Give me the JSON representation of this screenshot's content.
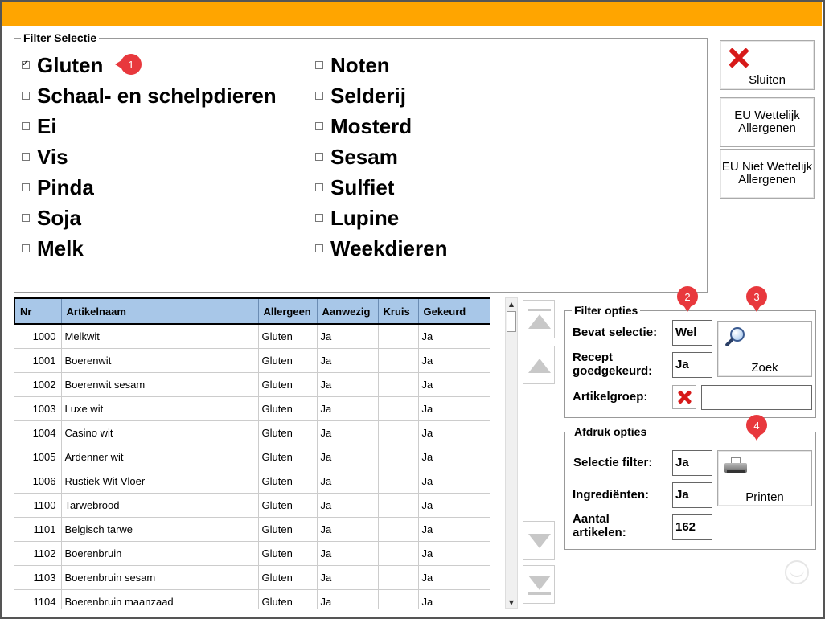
{
  "filter_selectie": {
    "title": "Filter Selectie",
    "left_column": [
      {
        "label": "Gluten",
        "checked": true
      },
      {
        "label": "Schaal- en schelpdieren",
        "checked": false
      },
      {
        "label": "Ei",
        "checked": false
      },
      {
        "label": "Vis",
        "checked": false
      },
      {
        "label": "Pinda",
        "checked": false
      },
      {
        "label": "Soja",
        "checked": false
      },
      {
        "label": "Melk",
        "checked": false
      }
    ],
    "right_column": [
      {
        "label": "Noten",
        "checked": false
      },
      {
        "label": "Selderij",
        "checked": false
      },
      {
        "label": "Mosterd",
        "checked": false
      },
      {
        "label": "Sesam",
        "checked": false
      },
      {
        "label": "Sulfiet",
        "checked": false
      },
      {
        "label": "Lupine",
        "checked": false
      },
      {
        "label": "Weekdieren",
        "checked": false
      }
    ]
  },
  "badges": [
    "1",
    "2",
    "3",
    "4"
  ],
  "buttons": {
    "sluiten": "Sluiten",
    "eu_wettelijk_line1": "EU Wettelijk",
    "eu_wettelijk_line2": "Allergenen",
    "eu_niet_line1": "EU Niet Wettelijk",
    "eu_niet_line2": "Allergenen"
  },
  "table": {
    "columns": [
      "Nr",
      "Artikelnaam",
      "Allergeen",
      "Aanwezig",
      "Kruis",
      "Gekeurd"
    ],
    "rows": [
      [
        "1000",
        "Melkwit",
        "Gluten",
        "Ja",
        "",
        "Ja"
      ],
      [
        "1001",
        "Boerenwit",
        "Gluten",
        "Ja",
        "",
        "Ja"
      ],
      [
        "1002",
        "Boerenwit sesam",
        "Gluten",
        "Ja",
        "",
        "Ja"
      ],
      [
        "1003",
        "Luxe wit",
        "Gluten",
        "Ja",
        "",
        "Ja"
      ],
      [
        "1004",
        "Casino wit",
        "Gluten",
        "Ja",
        "",
        "Ja"
      ],
      [
        "1005",
        "Ardenner wit",
        "Gluten",
        "Ja",
        "",
        "Ja"
      ],
      [
        "1006",
        "Rustiek Wit Vloer",
        "Gluten",
        "Ja",
        "",
        "Ja"
      ],
      [
        "1100",
        "Tarwebrood",
        "Gluten",
        "Ja",
        "",
        "Ja"
      ],
      [
        "1101",
        "Belgisch tarwe",
        "Gluten",
        "Ja",
        "",
        "Ja"
      ],
      [
        "1102",
        "Boerenbruin",
        "Gluten",
        "Ja",
        "",
        "Ja"
      ],
      [
        "1103",
        "Boerenbruin sesam",
        "Gluten",
        "Ja",
        "",
        "Ja"
      ],
      [
        "1104",
        "Boerenbruin maanzaad",
        "Gluten",
        "Ja",
        "",
        "Ja"
      ]
    ]
  },
  "filter_opties": {
    "title": "Filter opties",
    "bevat_selectie_label": "Bevat selectie:",
    "bevat_selectie_value": "Wel",
    "recept_label_line1": "Recept",
    "recept_label_line2": "goedgekeurd:",
    "recept_value": "Ja",
    "artikelgroep_label": "Artikelgroep:",
    "artikelgroep_value": "",
    "zoek_label": "Zoek"
  },
  "afdruk_opties": {
    "title": "Afdruk opties",
    "selectie_filter_label": "Selectie filter:",
    "selectie_filter_value": "Ja",
    "ingredienten_label": "Ingrediënten:",
    "ingredienten_value": "Ja",
    "aantal_label_line1": "Aantal",
    "aantal_label_line2": "artikelen:",
    "aantal_value": "162",
    "printen_label": "Printen"
  },
  "colors": {
    "topbar": "#FFA500",
    "header_bg": "#a8c7e8",
    "badge": "#e8383d",
    "close_x": "#d71a1a"
  }
}
